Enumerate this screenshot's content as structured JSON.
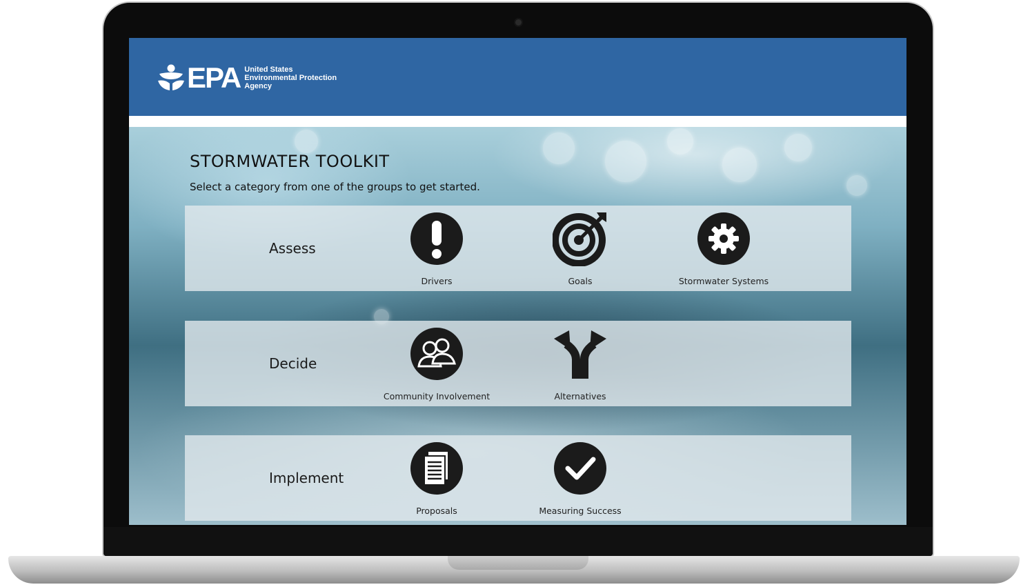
{
  "header": {
    "logo_text": "EPA",
    "agency_line1": "United States",
    "agency_line2": "Environmental Protection",
    "agency_line3": "Agency",
    "background_color": "#2f66a3"
  },
  "main": {
    "title": "STORMWATER TOOLKIT",
    "subtitle": "Select a category from one of the groups to get started."
  },
  "groups": [
    {
      "label": "Assess",
      "items": [
        {
          "label": "Drivers",
          "icon": "exclamation-icon"
        },
        {
          "label": "Goals",
          "icon": "target-icon"
        },
        {
          "label": "Stormwater Systems",
          "icon": "gear-icon"
        }
      ]
    },
    {
      "label": "Decide",
      "items": [
        {
          "label": "Community Involvement",
          "icon": "people-icon"
        },
        {
          "label": "Alternatives",
          "icon": "fork-arrows-icon"
        }
      ]
    },
    {
      "label": "Implement",
      "items": [
        {
          "label": "Proposals",
          "icon": "document-icon"
        },
        {
          "label": "Measuring Success",
          "icon": "checkmark-icon"
        }
      ]
    }
  ]
}
